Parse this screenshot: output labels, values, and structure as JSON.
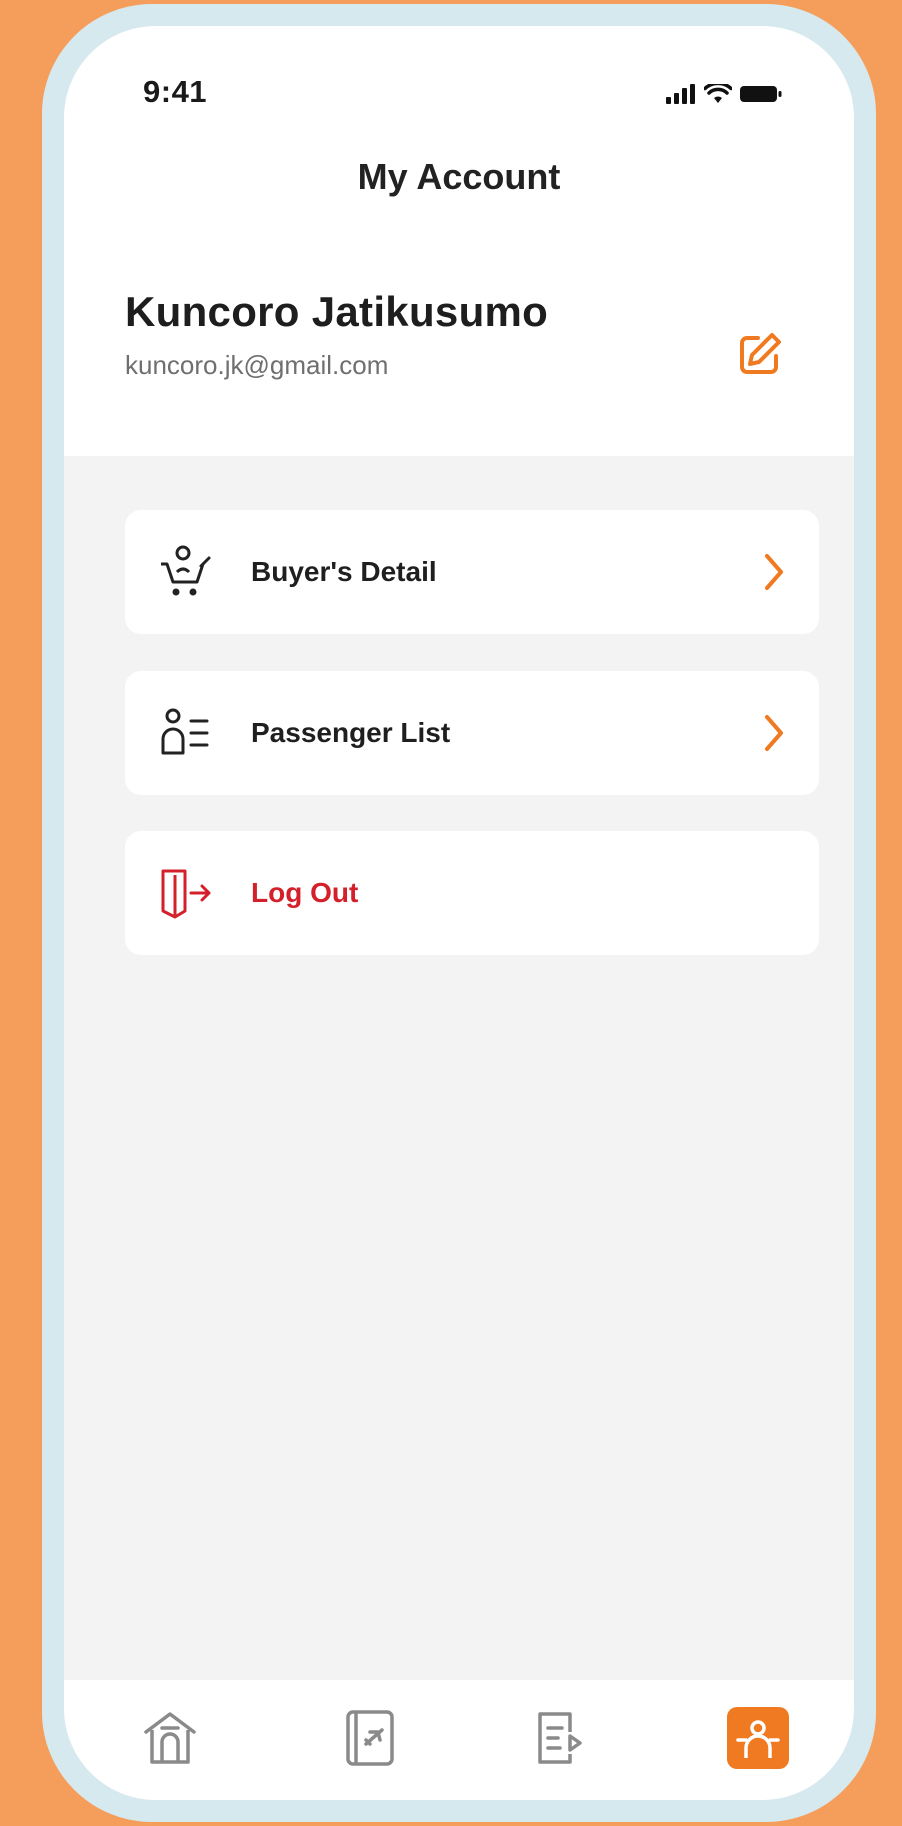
{
  "status_bar": {
    "time": "9:41",
    "icons": [
      "signal-icon",
      "wifi-icon",
      "battery-icon"
    ]
  },
  "header": {
    "title": "My Account"
  },
  "profile": {
    "name": "Kuncoro Jatikusumo",
    "email": "kuncoro.jk@gmail.com",
    "edit_icon": "edit-icon"
  },
  "menu": {
    "items": [
      {
        "label": "Buyer's Detail",
        "icon": "buyer-cart-icon",
        "has_chevron": true
      },
      {
        "label": "Passenger List",
        "icon": "passenger-list-icon",
        "has_chevron": true
      },
      {
        "label": "Log Out",
        "icon": "logout-door-icon",
        "has_chevron": false
      }
    ]
  },
  "bottom_nav": {
    "items": [
      {
        "icon": "home-icon",
        "active": false
      },
      {
        "icon": "flight-ticket-icon",
        "active": false
      },
      {
        "icon": "orders-icon",
        "active": false
      },
      {
        "icon": "account-icon",
        "active": true
      }
    ]
  },
  "colors": {
    "background": "#f59e5c",
    "accent": "#f07a22",
    "logout": "#d3202a",
    "frame": "#d6e9ef",
    "screen": "#f3f3f3"
  }
}
